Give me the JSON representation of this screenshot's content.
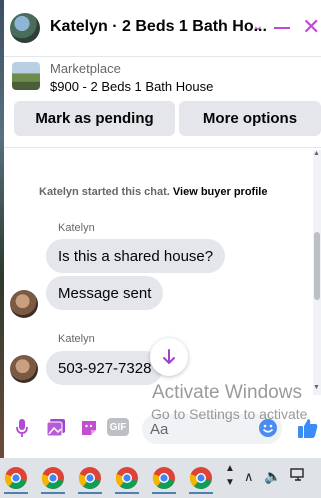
{
  "header": {
    "title": "Katelyn · 2 Beds 1 Bath Ho...",
    "accent_color": "#c04ad8"
  },
  "listing": {
    "source": "Marketplace",
    "title": "$900 - 2 Beds 1 Bath House"
  },
  "actions": {
    "mark_pending": "Mark as pending",
    "more_options": "More options"
  },
  "messages": {
    "system_prefix": "Katelyn started this chat.",
    "system_link": "View buyer profile",
    "items": [
      {
        "sender": "Katelyn",
        "text": "Is this a shared house?",
        "direction": "incoming"
      },
      {
        "sender": "",
        "text": "Message sent",
        "direction": "incoming"
      },
      {
        "sender": "Katelyn",
        "text": "503-927-7328",
        "direction": "incoming"
      }
    ]
  },
  "composer": {
    "gif_label": "GIF",
    "placeholder": "Aa",
    "icons": [
      "microphone-icon",
      "photo-icon",
      "sticker-icon",
      "gif-icon",
      "emoji-icon",
      "thumbs-up-icon"
    ]
  },
  "watermark": {
    "line1": "Activate Windows",
    "line2": "Go to Settings to activate"
  },
  "taskbar": {
    "app_icons": [
      "chrome-icon",
      "chrome-icon",
      "chrome-icon",
      "chrome-icon",
      "chrome-icon",
      "chrome-icon"
    ],
    "tray_icons": [
      "chevron-up-icon",
      "volume-icon",
      "network-icon"
    ]
  }
}
